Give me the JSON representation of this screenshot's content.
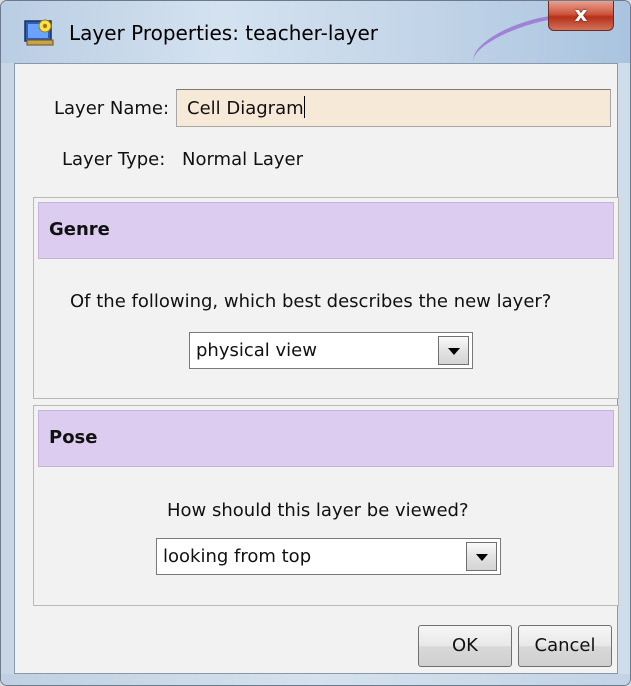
{
  "window": {
    "title": "Layer Properties: teacher-layer",
    "close_label": "x",
    "icon": "layer-app-icon"
  },
  "form": {
    "name_label": "Layer Name:",
    "name_value": "Cell Diagram",
    "type_label": "Layer Type:",
    "type_value": "Normal Layer"
  },
  "genre": {
    "title": "Genre",
    "question": "Of the following, which best describes the new layer?",
    "selected": "physical view"
  },
  "pose": {
    "title": "Pose",
    "question": "How should this layer be viewed?",
    "selected": "looking from top"
  },
  "buttons": {
    "ok": "OK",
    "cancel": "Cancel"
  },
  "colors": {
    "section_header": "#dccdf0",
    "input_background": "#f7e9d8",
    "close_button": "#c7412a"
  }
}
